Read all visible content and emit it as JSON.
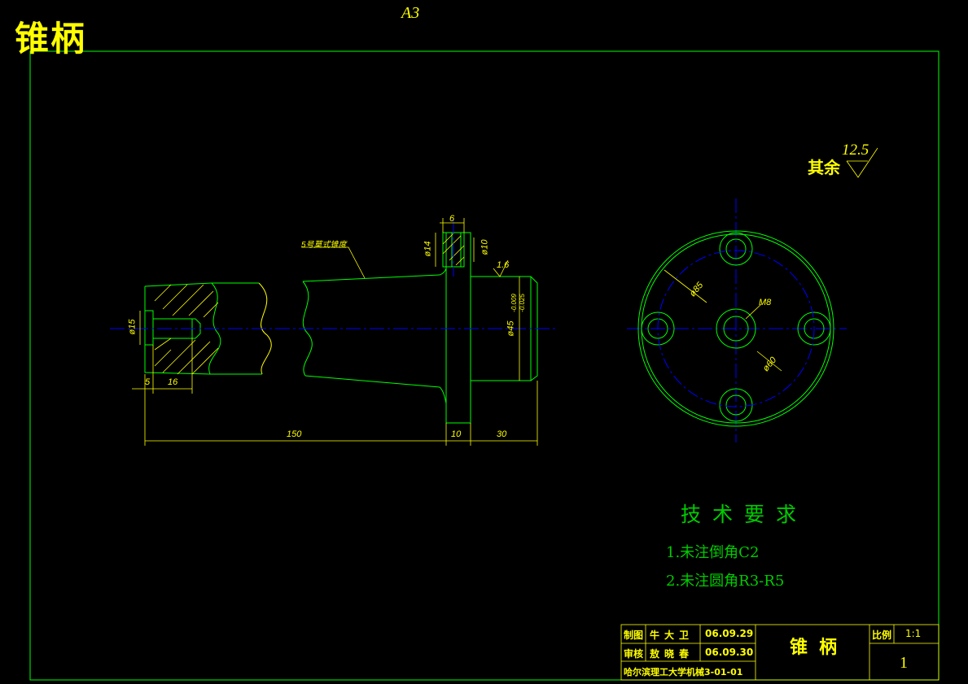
{
  "drawing": {
    "title": "锥柄",
    "sheet_size": "A3",
    "roughness_label": "其余",
    "roughness_value": "12.5"
  },
  "dimensions": {
    "taper_note": "5号莫式锥度",
    "width_6": "6",
    "dia_14": "ø14",
    "dia_10": "ø10",
    "surface_16": "1.6",
    "dia_15": "ø15",
    "dia_45": "ø45",
    "tol_upper": "-0.009",
    "tol_lower": "-0.025",
    "len_5": "5",
    "len_16": "16",
    "len_150": "150",
    "len_10": "10",
    "len_30": "30",
    "dia_85": "ø85",
    "dia_60": "ø60",
    "thread_m8": "M8"
  },
  "tech_requirements": {
    "title": "技术要求",
    "items": [
      "1.未注倒角C2",
      "2.未注圆角R3-R5"
    ]
  },
  "title_block": {
    "drawn_label": "制图",
    "drawn_name": "牛大卫",
    "drawn_date": "06.09.29",
    "check_label": "审核",
    "check_name": "敖晓春",
    "check_date": "06.09.30",
    "school": "哈尔滨理工大学机械3-01-01",
    "part_name": "锥柄",
    "scale_label": "比例",
    "scale_value": "1:1",
    "sheet_number": "1"
  },
  "colors": {
    "background": "#000000",
    "outline": "#00ff00",
    "dimension": "#ffff00",
    "centerline": "#0000ff",
    "text_green": "#00cc00"
  }
}
